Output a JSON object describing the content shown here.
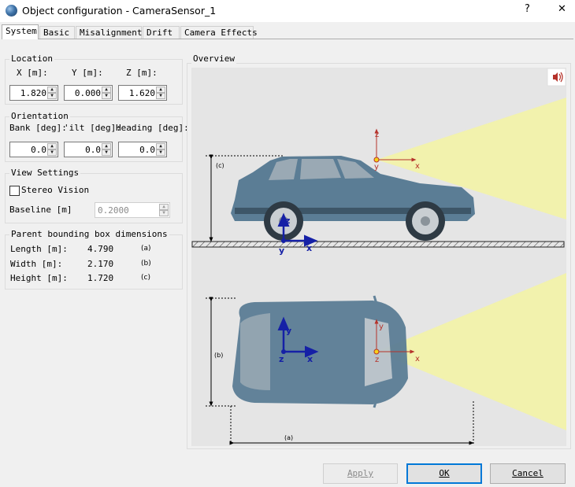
{
  "window": {
    "title": "Object configuration - CameraSensor_1",
    "help_glyph": "?",
    "close_glyph": "✕"
  },
  "tabs": [
    {
      "label": "System",
      "active": true
    },
    {
      "label": "Basic"
    },
    {
      "label": "Misalignment"
    },
    {
      "label": "Drift"
    },
    {
      "label": "Camera Effects"
    }
  ],
  "location": {
    "title": "Location",
    "x_label": "X  [m]:",
    "y_label": "Y [m]:",
    "z_label": "Z [m]:",
    "x_value": "1.820",
    "y_value": "0.000",
    "z_value": "1.620"
  },
  "orientation": {
    "title": "Orientation",
    "bank_label": "Bank [deg]:",
    "tilt_label": "'ilt [deg]:",
    "heading_label": "Heading [deg]:",
    "bank_value": "0.0",
    "tilt_value": "0.0",
    "heading_value": "0.0"
  },
  "view_settings": {
    "title": "View Settings",
    "stereo_label": "Stereo Vision",
    "stereo_checked": false,
    "baseline_label": "Baseline [m]",
    "baseline_value": "0.2000"
  },
  "bbox": {
    "title": "Parent bounding box dimensions",
    "rows": [
      {
        "label": "Length [m]:",
        "value": "4.790",
        "tag": "(a)"
      },
      {
        "label": "Width [m]:",
        "value": "2.170",
        "tag": "(b)"
      },
      {
        "label": "Height [m]:",
        "value": "1.720",
        "tag": "(c)"
      }
    ]
  },
  "overview": {
    "title": "Overview",
    "dim_a": "(a)",
    "dim_b": "(b)",
    "dim_c": "(c)",
    "axis_x": "x",
    "axis_y": "y",
    "axis_z": "z"
  },
  "buttons": {
    "apply": "Apply",
    "ok": "OK",
    "cancel": "Cancel"
  },
  "colors": {
    "axis_blue": "#1520a6",
    "axis_red": "#b5322a",
    "fov_yellow": "#f3f3a6",
    "car_body": "#5b7d95",
    "accent_border": "#0078d7"
  }
}
